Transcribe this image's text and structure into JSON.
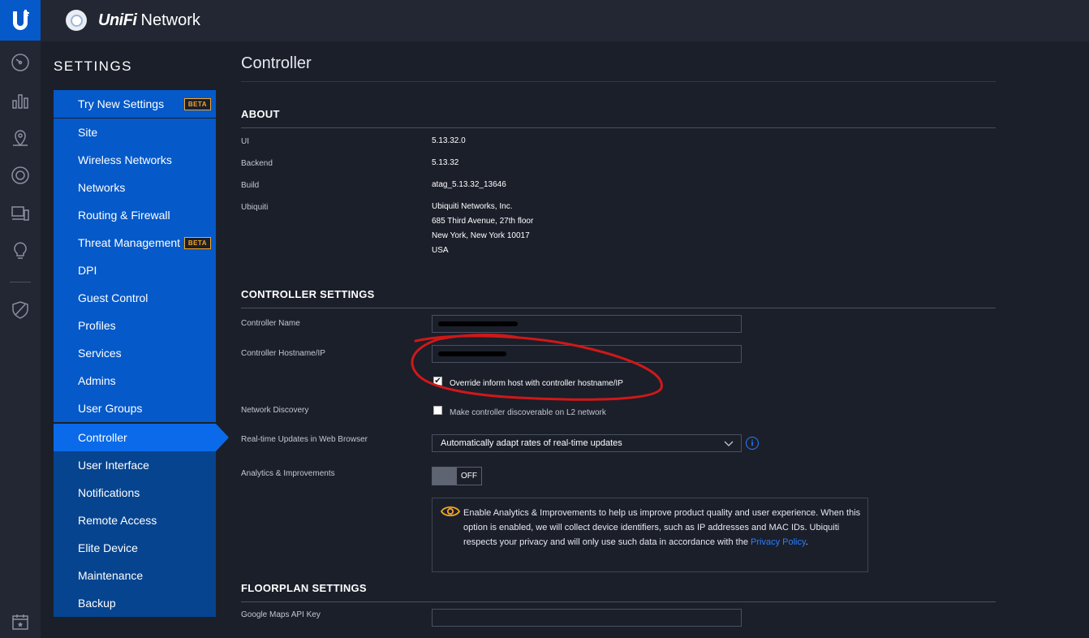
{
  "app": {
    "brand": "UniFi",
    "product": "Network"
  },
  "settings": {
    "heading": "SETTINGS",
    "items": [
      {
        "label": "Try New Settings",
        "badge": "BETA"
      },
      {
        "label": "Site"
      },
      {
        "label": "Wireless Networks"
      },
      {
        "label": "Networks"
      },
      {
        "label": "Routing & Firewall"
      },
      {
        "label": "Threat Management",
        "badge": "BETA"
      },
      {
        "label": "DPI"
      },
      {
        "label": "Guest Control"
      },
      {
        "label": "Profiles"
      },
      {
        "label": "Services"
      },
      {
        "label": "Admins"
      },
      {
        "label": "User Groups"
      },
      {
        "label": "Controller"
      },
      {
        "label": "User Interface"
      },
      {
        "label": "Notifications"
      },
      {
        "label": "Remote Access"
      },
      {
        "label": "Elite Device"
      },
      {
        "label": "Maintenance"
      },
      {
        "label": "Backup"
      }
    ],
    "active": "Controller"
  },
  "page": {
    "title": "Controller"
  },
  "about": {
    "heading": "ABOUT",
    "ui_label": "UI",
    "ui_value": "5.13.32.0",
    "backend_label": "Backend",
    "backend_value": "5.13.32",
    "build_label": "Build",
    "build_value": "atag_5.13.32_13646",
    "ubiquiti_label": "Ubiquiti",
    "address": [
      "Ubiquiti Networks, Inc.",
      "685 Third Avenue, 27th floor",
      "New York, New York 10017",
      "USA"
    ]
  },
  "controller_settings": {
    "heading": "CONTROLLER SETTINGS",
    "name_label": "Controller Name",
    "hostname_label": "Controller Hostname/IP",
    "override_label": "Override inform host with controller hostname/IP",
    "override_checked": true,
    "discovery_label": "Network Discovery",
    "discovery_option": "Make controller discoverable on L2 network",
    "discovery_checked": false,
    "realtime_label": "Real-time Updates in Web Browser",
    "realtime_value": "Automatically adapt rates of real-time updates",
    "analytics_label": "Analytics & Improvements",
    "analytics_state": "OFF",
    "notice_text": "Enable Analytics & Improvements to help us improve product quality and user experience. When this option is enabled, we will collect device identifiers, such as IP addresses and MAC IDs. Ubiquiti respects your privacy and will only use such data in accordance with the",
    "notice_link": "Privacy Policy",
    "notice_end": "."
  },
  "floorplan": {
    "heading": "FLOORPLAN SETTINGS",
    "maps_label": "Google Maps API Key"
  },
  "colors": {
    "accent": "#0559c9",
    "menu_dark": "#06448f",
    "background": "#1b1f2a",
    "beta": "#f5a623",
    "annotation": "#d01818"
  }
}
